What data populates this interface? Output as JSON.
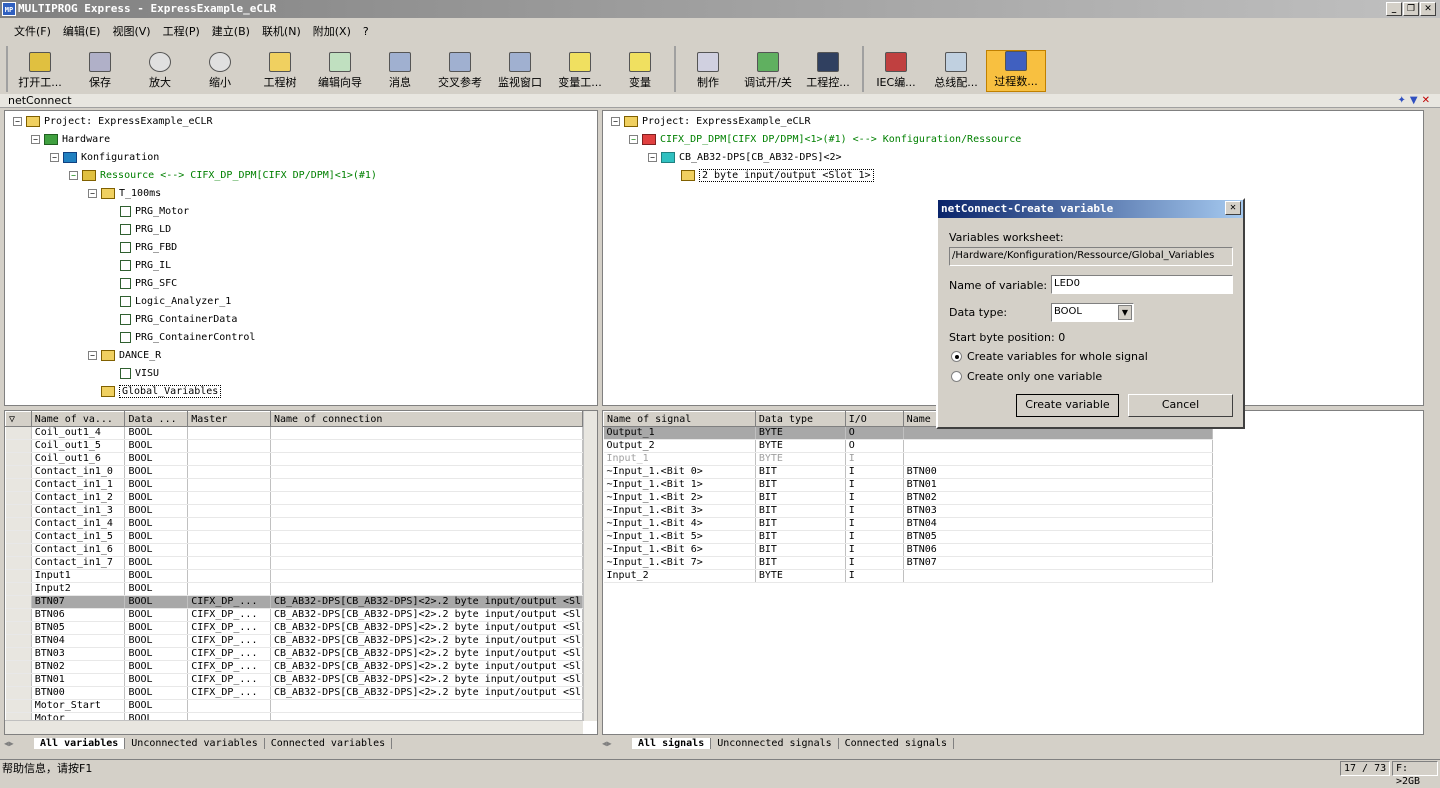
{
  "window": {
    "title": "MULTIPROG Express - ExpressExample_eCLR",
    "icon_text": "MP"
  },
  "menu": [
    "文件(F)",
    "编辑(E)",
    "视图(V)",
    "工程(P)",
    "建立(B)",
    "联机(N)",
    "附加(X)",
    "?"
  ],
  "toolbar": {
    "group1": [
      "打开工...",
      "保存",
      "放大",
      "缩小",
      "工程树",
      "编辑向导",
      "消息",
      "交叉参考",
      "监视窗口",
      "变量工...",
      "变量"
    ],
    "group2": [
      "制作",
      "调试开/关",
      "工程控..."
    ],
    "group3": [
      "IEC编...",
      "总线配...",
      "过程数..."
    ]
  },
  "panel_title": "netConnect",
  "left_tree": {
    "items": [
      {
        "label": "Project: ExpressExample_eCLR"
      },
      {
        "label": "Hardware"
      },
      {
        "label": "Konfiguration"
      },
      {
        "label": "Ressource <--> CIFX_DP_DPM[CIFX DP/DPM]<1>(#1)"
      },
      {
        "label": "T_100ms"
      },
      {
        "label": "PRG_Motor"
      },
      {
        "label": "PRG_LD"
      },
      {
        "label": "PRG_FBD"
      },
      {
        "label": "PRG_IL"
      },
      {
        "label": "PRG_SFC"
      },
      {
        "label": "Logic_Analyzer_1"
      },
      {
        "label": "PRG_ContainerData"
      },
      {
        "label": "PRG_ContainerControl"
      },
      {
        "label": "DANCE_R"
      },
      {
        "label": "VISU"
      },
      {
        "label": "Global_Variables"
      }
    ]
  },
  "right_tree": {
    "items": [
      {
        "label": "Project: ExpressExample_eCLR"
      },
      {
        "label": "CIFX_DP_DPM[CIFX DP/DPM]<1>(#1) <--> Konfiguration/Ressource"
      },
      {
        "label": "CB_AB32-DPS[CB_AB32-DPS]<2>"
      },
      {
        "label": "2 byte input/output <Slot 1>"
      }
    ]
  },
  "var_table": {
    "headers": [
      "Name of va...",
      "Data ...",
      "Master",
      "Name of connection"
    ],
    "rows": [
      [
        "Coil_out1_4",
        "BOOL",
        "",
        ""
      ],
      [
        "Coil_out1_5",
        "BOOL",
        "",
        ""
      ],
      [
        "Coil_out1_6",
        "BOOL",
        "",
        ""
      ],
      [
        "Contact_in1_0",
        "BOOL",
        "",
        ""
      ],
      [
        "Contact_in1_1",
        "BOOL",
        "",
        ""
      ],
      [
        "Contact_in1_2",
        "BOOL",
        "",
        ""
      ],
      [
        "Contact_in1_3",
        "BOOL",
        "",
        ""
      ],
      [
        "Contact_in1_4",
        "BOOL",
        "",
        ""
      ],
      [
        "Contact_in1_5",
        "BOOL",
        "",
        ""
      ],
      [
        "Contact_in1_6",
        "BOOL",
        "",
        ""
      ],
      [
        "Contact_in1_7",
        "BOOL",
        "",
        ""
      ],
      [
        "Input1",
        "BOOL",
        "",
        ""
      ],
      [
        "Input2",
        "BOOL",
        "",
        ""
      ],
      [
        "BTN07",
        "BOOL",
        "CIFX_DP_...",
        "CB_AB32-DPS[CB_AB32-DPS]<2>.2 byte input/output <Sl"
      ],
      [
        "BTN06",
        "BOOL",
        "CIFX_DP_...",
        "CB_AB32-DPS[CB_AB32-DPS]<2>.2 byte input/output <Sl"
      ],
      [
        "BTN05",
        "BOOL",
        "CIFX_DP_...",
        "CB_AB32-DPS[CB_AB32-DPS]<2>.2 byte input/output <Sl"
      ],
      [
        "BTN04",
        "BOOL",
        "CIFX_DP_...",
        "CB_AB32-DPS[CB_AB32-DPS]<2>.2 byte input/output <Sl"
      ],
      [
        "BTN03",
        "BOOL",
        "CIFX_DP_...",
        "CB_AB32-DPS[CB_AB32-DPS]<2>.2 byte input/output <Sl"
      ],
      [
        "BTN02",
        "BOOL",
        "CIFX_DP_...",
        "CB_AB32-DPS[CB_AB32-DPS]<2>.2 byte input/output <Sl"
      ],
      [
        "BTN01",
        "BOOL",
        "CIFX_DP_...",
        "CB_AB32-DPS[CB_AB32-DPS]<2>.2 byte input/output <Sl"
      ],
      [
        "BTN00",
        "BOOL",
        "CIFX_DP_...",
        "CB_AB32-DPS[CB_AB32-DPS]<2>.2 byte input/output <Sl"
      ],
      [
        "Motor_Start",
        "BOOL",
        "",
        ""
      ],
      [
        "Motor_",
        "BOOL",
        "",
        ""
      ]
    ],
    "highlight_row": 13
  },
  "sig_table": {
    "headers": [
      "Name of signal",
      "Data type",
      "I/O",
      "Name",
      ""
    ],
    "rows": [
      [
        "Output_1",
        "BYTE",
        "O",
        "",
        ""
      ],
      [
        "Output_2",
        "BYTE",
        "O",
        "",
        ""
      ],
      [
        "Input_1",
        "BYTE",
        "I",
        "",
        ""
      ],
      [
        "~Input_1.<Bit 0>",
        "BIT",
        "I",
        "BTN00",
        ""
      ],
      [
        "~Input_1.<Bit 1>",
        "BIT",
        "I",
        "BTN01",
        ""
      ],
      [
        "~Input_1.<Bit 2>",
        "BIT",
        "I",
        "BTN02",
        ""
      ],
      [
        "~Input_1.<Bit 3>",
        "BIT",
        "I",
        "BTN03",
        ""
      ],
      [
        "~Input_1.<Bit 4>",
        "BIT",
        "I",
        "BTN04",
        ""
      ],
      [
        "~Input_1.<Bit 5>",
        "BIT",
        "I",
        "BTN05",
        ""
      ],
      [
        "~Input_1.<Bit 6>",
        "BIT",
        "I",
        "BTN06",
        ""
      ],
      [
        "~Input_1.<Bit 7>",
        "BIT",
        "I",
        "BTN07",
        ""
      ],
      [
        "Input_2",
        "BYTE",
        "I",
        "",
        ""
      ]
    ],
    "highlight_row": 0,
    "dim_row": 2
  },
  "left_tabs": [
    "All variables",
    "Unconnected variables",
    "Connected variables"
  ],
  "right_tabs": [
    "All signals",
    "Unconnected signals",
    "Connected signals"
  ],
  "dialog": {
    "title": "netConnect-Create variable",
    "worksheet_label": "Variables worksheet:",
    "worksheet_value": "/Hardware/Konfiguration/Ressource/Global_Variables",
    "name_label": "Name of variable:",
    "name_value": "LED0",
    "type_label": "Data type:",
    "type_value": "BOOL",
    "start_byte": "Start byte position: 0",
    "radio_whole": "Create variables for whole signal",
    "radio_one": "Create only one variable",
    "create_btn": "Create variable",
    "cancel_btn": "Cancel"
  },
  "status": {
    "help": "帮助信息，请按F1",
    "position": "17 / 73",
    "free": "F: >2GB"
  },
  "colors": {
    "active_tool": "#f8c040",
    "highlight_row": "#a8a8a8",
    "tree_green": "#008000",
    "dialog_title": "#0a246a"
  }
}
